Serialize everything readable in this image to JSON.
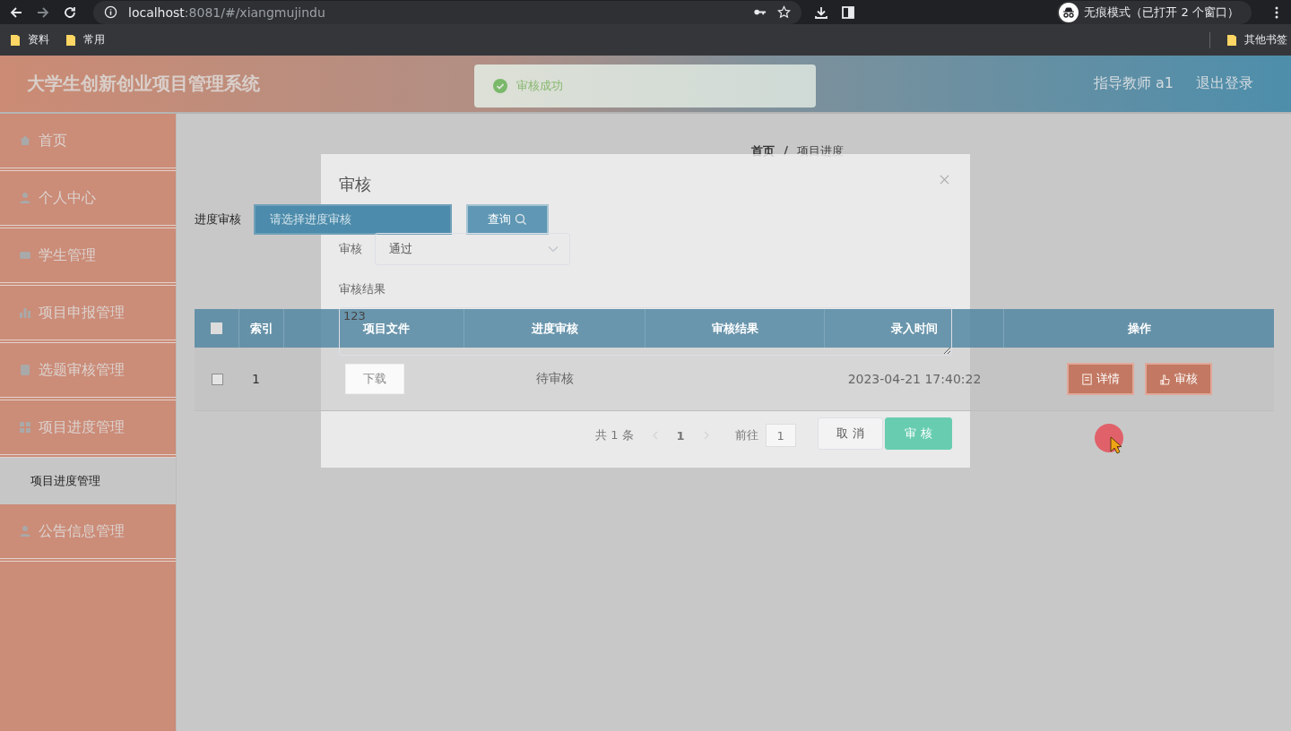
{
  "browser": {
    "url_host": "localhost",
    "url_rest": ":8081/#/xiangmujindu",
    "incognito_label": "无痕模式（已打开 2 个窗口）",
    "bookmarks": [
      "资料",
      "常用"
    ],
    "other_bookmarks": "其他书签"
  },
  "header": {
    "title": "大学生创新创业项目管理系统",
    "user": "指导教师 a1",
    "logout": "退出登录"
  },
  "toast": {
    "kind": "success",
    "message": "审核成功"
  },
  "sidebar": {
    "items": [
      {
        "label": "首页"
      },
      {
        "label": "个人中心"
      },
      {
        "label": "学生管理"
      },
      {
        "label": "项目申报管理"
      },
      {
        "label": "选题审核管理"
      },
      {
        "label": "项目进度管理",
        "children": [
          {
            "label": "项目进度管理",
            "selected": true
          }
        ]
      },
      {
        "label": "公告信息管理"
      }
    ]
  },
  "breadcrumb": {
    "separator": "/",
    "items": [
      "首页",
      "项目进度"
    ]
  },
  "search": {
    "label": "进度审核",
    "placeholder": "请选择进度审核",
    "button": "查询"
  },
  "table": {
    "all_checked": false,
    "columns": [
      "索引",
      "项目文件",
      "进度审核",
      "审核结果",
      "录入时间",
      "操作"
    ],
    "rows": [
      {
        "checked": false,
        "index": "1",
        "file_button": "下载",
        "progress_review": "待审核",
        "time": "2023-04-21 17:40:22",
        "actions": [
          "详情",
          "审核"
        ]
      }
    ]
  },
  "pagination": {
    "total": "共 1 条",
    "page": "1",
    "goto_label": "前往",
    "goto_value": "1"
  },
  "dialog": {
    "title": "审核",
    "fields": [
      {
        "kind": "select",
        "label": "审核",
        "value": "通过"
      },
      {
        "kind": "textarea",
        "label": "审核结果",
        "value": "123"
      }
    ],
    "buttons": [
      {
        "kind": "default",
        "label": "取 消"
      },
      {
        "kind": "primary",
        "label": "审 核"
      }
    ]
  }
}
